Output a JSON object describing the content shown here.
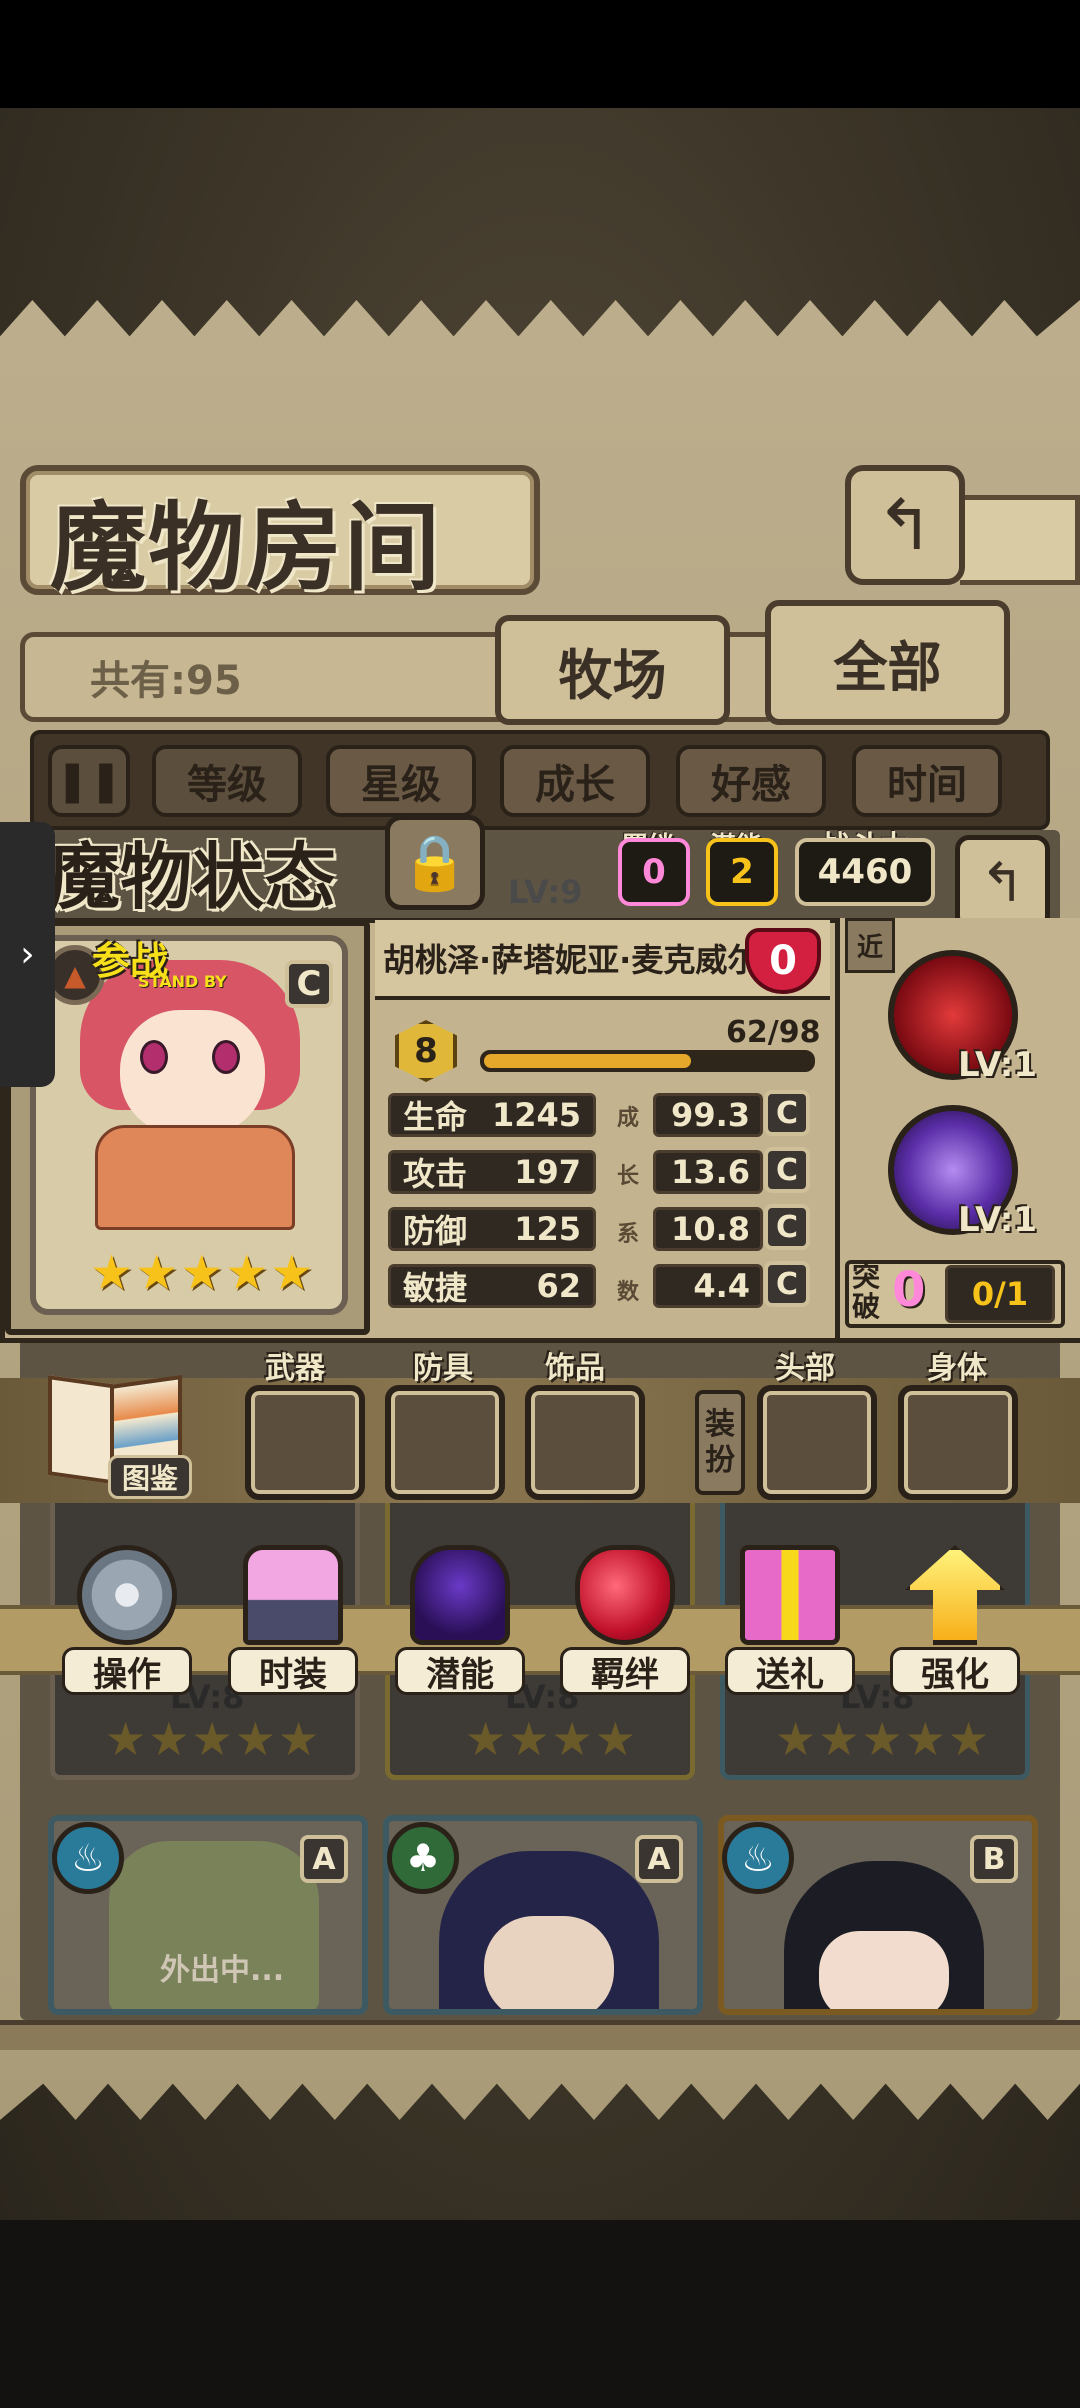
{
  "header": {
    "title": "魔物房间",
    "count_label": "共有:95",
    "tabs": [
      "牧场",
      "全部"
    ]
  },
  "sort_buttons": [
    "等级",
    "星级",
    "成长",
    "好感",
    "时间"
  ],
  "status": {
    "title": "魔物状态",
    "bond_label": "羁绊",
    "bond_value": "0",
    "potential_label": "潜能",
    "potential_value": "2",
    "power_label": "战斗力",
    "power_value": "4460",
    "lock_behind_lv": "LV:9"
  },
  "monster": {
    "name": "胡桃泽·萨塔妮亚·麦克威尔",
    "affection": "0",
    "standby_label": "参战",
    "standby_sub": "STAND BY",
    "rank": "C",
    "stars": 5,
    "level": "8",
    "exp_text": "62/98",
    "exp_fraction": 0.633,
    "stats": [
      {
        "name": "生命",
        "value": "1245",
        "growth": "99.3",
        "grade": "C"
      },
      {
        "name": "攻击",
        "value": "197",
        "growth": "13.6",
        "grade": "C"
      },
      {
        "name": "防御",
        "value": "125",
        "growth": "10.8",
        "grade": "C"
      },
      {
        "name": "敏捷",
        "value": "62",
        "growth": "4.4",
        "grade": "C"
      }
    ],
    "growth_vertical": [
      "成",
      "长",
      "系",
      "数"
    ],
    "range_tag": "近",
    "skills": [
      {
        "icon": "claw-slash-icon",
        "level": "LV:1",
        "color": "#b1101c"
      },
      {
        "icon": "shadow-demon-icon",
        "level": "LV:1",
        "color": "#5b2ea8"
      }
    ],
    "breakthrough_label": "突破",
    "breakthrough_count": "0",
    "breakthrough_progress": "0/1"
  },
  "equipment": {
    "codex_label": "图鉴",
    "slots": [
      "武器",
      "防具",
      "饰品"
    ],
    "dress_label": "装扮",
    "costume_slots": [
      "头部",
      "身体"
    ]
  },
  "actions": [
    {
      "label": "操作",
      "icon": "gear-icon"
    },
    {
      "label": "时装",
      "icon": "outfit-icon"
    },
    {
      "label": "潜能",
      "icon": "demon-silhouette-icon"
    },
    {
      "label": "羁绊",
      "icon": "double-heart-icon"
    },
    {
      "label": "送礼",
      "icon": "gift-icon"
    },
    {
      "label": "强化",
      "icon": "up-arrows-icon"
    }
  ],
  "background_cards": [
    {
      "rank": "A",
      "element": "water",
      "status": "外出中..."
    },
    {
      "rank": "A",
      "element": "leaf",
      "status": ""
    },
    {
      "rank": "B",
      "element": "water",
      "status": ""
    }
  ],
  "background_lv_labels": [
    "LV:8",
    "LV:8",
    "LV:8"
  ],
  "colors": {
    "gold": "#f7c21a",
    "heart_red": "#d42040",
    "pink_count": "#ff88d8"
  }
}
